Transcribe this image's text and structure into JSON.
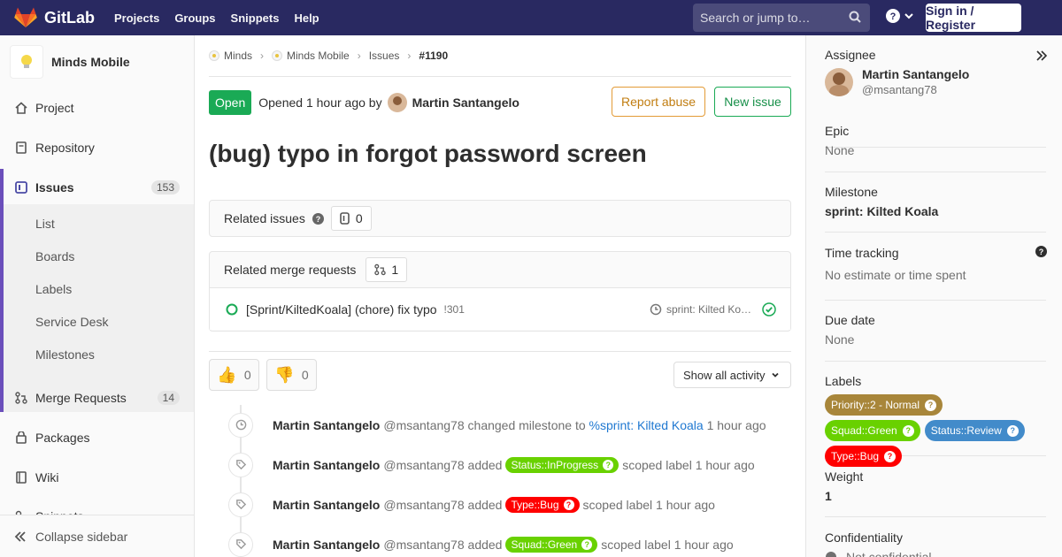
{
  "topbar": {
    "brand": "GitLab",
    "nav": [
      "Projects",
      "Groups",
      "Snippets",
      "Help"
    ],
    "search_placeholder": "Search or jump to…",
    "signin": "Sign in / Register",
    "bg_color": "#292961"
  },
  "sidebar": {
    "project_name": "Minds Mobile",
    "items": [
      {
        "label": "Project",
        "icon": "home-icon"
      },
      {
        "label": "Repository",
        "icon": "doc-icon"
      },
      {
        "label": "Issues",
        "icon": "issues-icon",
        "badge": "153"
      },
      {
        "label": "Merge Requests",
        "icon": "merge-icon",
        "badge": "14"
      },
      {
        "label": "Packages",
        "icon": "package-icon"
      },
      {
        "label": "Wiki",
        "icon": "book-icon"
      },
      {
        "label": "Snippets",
        "icon": "snippet-icon"
      }
    ],
    "issue_subitems": [
      "List",
      "Boards",
      "Labels",
      "Service Desk",
      "Milestones"
    ],
    "collapse": "Collapse sidebar"
  },
  "breadcrumbs": [
    "Minds",
    "Minds Mobile",
    "Issues",
    "#1190"
  ],
  "issue": {
    "status": "Open",
    "opened_text": "Opened 1 hour ago by",
    "author": "Martin Santangelo",
    "title": "(bug) typo in forgot password screen",
    "report_abuse": "Report abuse",
    "new_issue": "New issue"
  },
  "related_issues": {
    "title": "Related issues",
    "count": "0"
  },
  "related_mrs": {
    "title": "Related merge requests",
    "count": "1",
    "items": [
      {
        "title": "[Sprint/KiltedKoala] (chore) fix typo",
        "ref": "!301",
        "milestone": "sprint: Kilted Ko…"
      }
    ]
  },
  "reactions": {
    "thumbs_up": "0",
    "thumbs_down": "0"
  },
  "activity_filter": "Show all activity",
  "timeline": [
    {
      "author": "Martin Santangelo",
      "handle": "@msantang78",
      "pre": "changed milestone to",
      "link": "%sprint: Kilted Koala",
      "post": "1 hour ago",
      "icon": "clock-icon"
    },
    {
      "author": "Martin Santangelo",
      "handle": "@msantang78",
      "pre": "added",
      "label": "Status::InProgress",
      "label_color": "#69d100",
      "post": "scoped label 1 hour ago",
      "icon": "tag-icon"
    },
    {
      "author": "Martin Santangelo",
      "handle": "@msantang78",
      "pre": "added",
      "label": "Type::Bug",
      "label_color": "#ff0000",
      "post": "scoped label 1 hour ago",
      "icon": "tag-icon"
    },
    {
      "author": "Martin Santangelo",
      "handle": "@msantang78",
      "pre": "added",
      "label": "Squad::Green",
      "label_color": "#69d100",
      "post": "scoped label 1 hour ago",
      "icon": "tag-icon"
    }
  ],
  "right_sidebar": {
    "assignee": {
      "title": "Assignee",
      "name": "Martin Santangelo",
      "handle": "@msantang78"
    },
    "epic": {
      "title": "Epic",
      "value": "None"
    },
    "milestone": {
      "title": "Milestone",
      "value": "sprint: Kilted Koala"
    },
    "time_tracking": {
      "title": "Time tracking",
      "value": "No estimate or time spent"
    },
    "due_date": {
      "title": "Due date",
      "value": "None"
    },
    "labels": {
      "title": "Labels",
      "items": [
        {
          "text": "Priority::2 - Normal",
          "color": "#a8863a"
        },
        {
          "text": "Squad::Green",
          "color": "#69d100"
        },
        {
          "text": "Status::Review",
          "color": "#428bca"
        },
        {
          "text": "Type::Bug",
          "color": "#ff0000"
        }
      ]
    },
    "weight": {
      "title": "Weight",
      "value": "1"
    },
    "confidentiality": {
      "title": "Confidentiality",
      "value": "Not confidential"
    }
  }
}
